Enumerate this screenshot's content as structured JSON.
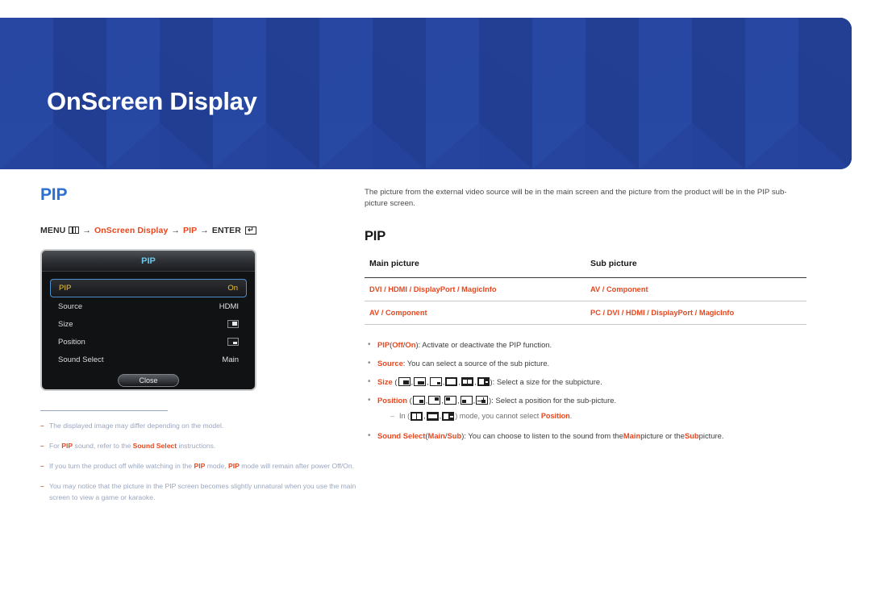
{
  "header": {
    "title": "OnScreen Display",
    "bg_color": "#24429b"
  },
  "left": {
    "heading": "PIP",
    "heading_color": "#2b6fd0",
    "menu_path": {
      "menu_label": "MENU",
      "menu_icon": "menu-bars-icon",
      "arrow1": "→",
      "item1": "OnScreen Display",
      "arrow2": "→",
      "item2": "PIP",
      "arrow3": "→",
      "enter_label": "ENTER",
      "enter_icon": "enter-return-icon",
      "enter_glyph": "↵",
      "highlight_color": "#e8471e"
    },
    "osd": {
      "title": "PIP",
      "title_color": "#6fc5e8",
      "rows": [
        {
          "label": "PIP",
          "value": "On",
          "selected": true,
          "kind": "text"
        },
        {
          "label": "Source",
          "value": "HDMI",
          "selected": false,
          "kind": "text"
        },
        {
          "label": "Size",
          "value": "",
          "selected": false,
          "kind": "thumb-size"
        },
        {
          "label": "Position",
          "value": "",
          "selected": false,
          "kind": "thumb-position"
        },
        {
          "label": "Sound Select",
          "value": "Main",
          "selected": false,
          "kind": "text"
        }
      ],
      "close_label": "Close"
    },
    "footnotes": [
      {
        "dash": "–",
        "parts": [
          {
            "t": "The displayed image may differ depending on the model.",
            "b": false
          }
        ]
      },
      {
        "dash": "–",
        "parts": [
          {
            "t": "For ",
            "b": false
          },
          {
            "t": "PIP",
            "b": true
          },
          {
            "t": " sound, refer to the ",
            "b": false
          },
          {
            "t": "Sound Select",
            "b": true
          },
          {
            "t": " instructions.",
            "b": false
          }
        ]
      },
      {
        "dash": "–",
        "parts": [
          {
            "t": "If you turn the product off while watching in the ",
            "b": false
          },
          {
            "t": "PIP",
            "b": true
          },
          {
            "t": " mode, ",
            "b": false
          },
          {
            "t": "PIP",
            "b": true
          },
          {
            "t": " mode will remain after power Off/On.",
            "b": false
          }
        ]
      },
      {
        "dash": "–",
        "parts": [
          {
            "t": "You may notice that the picture in the PIP screen becomes slightly unnatural when you use the main screen to view a game or karaoke.",
            "b": false
          }
        ]
      }
    ]
  },
  "right": {
    "intro": "The picture from the external video source will be in the main screen and the picture from the product will be in the PIP sub-picture screen.",
    "heading": "PIP",
    "table": {
      "headers": [
        "Main picture",
        "Sub picture"
      ],
      "rows": [
        [
          "DVI / HDMI / DisplayPort / MagicInfo",
          "AV / Component"
        ],
        [
          "AV / Component",
          "PC / DVI / HDMI / DisplayPort / MagicInfo"
        ]
      ]
    },
    "bullets": [
      {
        "dot": "•",
        "parts": [
          {
            "t": "PIP",
            "b": true
          },
          {
            "t": " (",
            "b": false
          },
          {
            "t": "Off",
            "b": true
          },
          {
            "t": " / ",
            "b": false
          },
          {
            "t": "On",
            "b": true
          },
          {
            "t": "): Activate or deactivate the PIP function.",
            "b": false
          }
        ]
      },
      {
        "dot": "•",
        "parts": [
          {
            "t": "Source",
            "b": true
          },
          {
            "t": ": You can select a source of the sub picture.",
            "b": false
          }
        ]
      },
      {
        "dot": "•",
        "icons": "size",
        "pre": [
          {
            "t": "Size",
            "b": true
          },
          {
            "t": " (",
            "b": false
          }
        ],
        "post": [
          {
            "t": "): Select a size for the subpicture.",
            "b": false
          }
        ]
      },
      {
        "dot": "•",
        "icons": "position",
        "pre": [
          {
            "t": "Position",
            "b": true
          },
          {
            "t": " (",
            "b": false
          }
        ],
        "post": [
          {
            "t": "): Select a position for the sub-picture.",
            "b": false
          }
        ]
      }
    ],
    "subnote": {
      "dash": "–",
      "pre": [
        {
          "t": "In (",
          "b": false
        }
      ],
      "post": [
        {
          "t": ") mode, you cannot select ",
          "b": false
        },
        {
          "t": "Position",
          "b": true
        },
        {
          "t": ".",
          "b": false
        }
      ]
    },
    "last_bullet": {
      "dot": "•",
      "parts": [
        {
          "t": "Sound Select",
          "b": true
        },
        {
          "t": " (",
          "b": false
        },
        {
          "t": "Main",
          "b": true
        },
        {
          "t": " / ",
          "b": false
        },
        {
          "t": "Sub",
          "b": true
        },
        {
          "t": "): You can choose to listen to the sound from the ",
          "b": false
        },
        {
          "t": "Main",
          "b": true
        },
        {
          "t": " picture or the ",
          "b": false
        },
        {
          "t": "Sub",
          "b": true
        },
        {
          "t": " picture.",
          "b": false
        }
      ]
    },
    "icon_sets": {
      "size": [
        "size-small-br-icon",
        "size-wide-br-icon",
        "size-tiny-br-icon",
        "size-split-vertical-icon",
        "size-split-quad-icon",
        "size-split-side-icon"
      ],
      "position": [
        "position-bottom-right-icon",
        "position-top-right-icon",
        "position-top-left-icon",
        "position-bottom-left-icon",
        "position-move-icon"
      ],
      "subnote": [
        "size-split-vertical-icon",
        "size-split-quad-icon",
        "size-split-side-icon"
      ]
    }
  }
}
